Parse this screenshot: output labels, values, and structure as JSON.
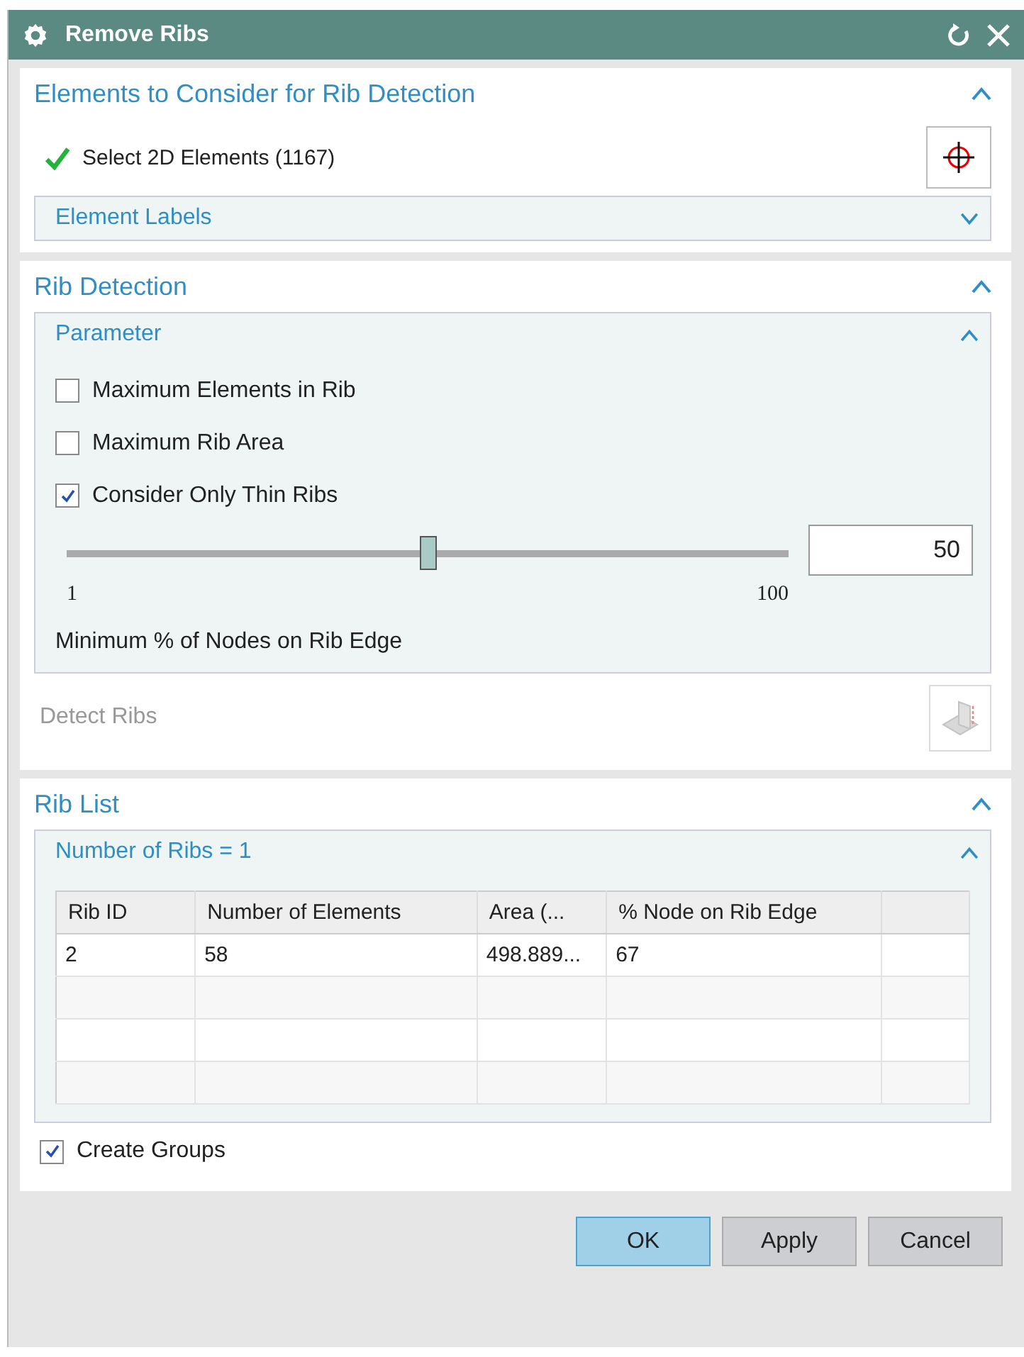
{
  "window": {
    "title": "Remove Ribs"
  },
  "sections": [
    {
      "kind": "selection",
      "title": "Elements to Consider for Rib Detection",
      "expanded": true,
      "selection": {
        "label": "Select 2D Elements (1167)",
        "complete": true
      },
      "subgroups": [
        {
          "title": "Element Labels",
          "expanded": false
        }
      ]
    },
    {
      "kind": "detection",
      "title": "Rib Detection",
      "expanded": true,
      "parameter": {
        "title": "Parameter",
        "expanded": true,
        "checks": [
          {
            "label": "Maximum Elements in Rib",
            "checked": false
          },
          {
            "label": "Maximum Rib Area",
            "checked": false
          },
          {
            "label": "Consider Only Thin Ribs",
            "checked": true
          }
        ],
        "slider": {
          "level": 0.5,
          "value": "50",
          "min": "1",
          "max": "100",
          "caption": "Minimum % of Nodes on Rib Edge"
        }
      },
      "action": {
        "label": "Detect Ribs",
        "disabled": true
      }
    },
    {
      "kind": "list",
      "title": "Rib List",
      "expanded": true,
      "group": {
        "title": "Number of Ribs = 1",
        "expanded": true
      },
      "table": {
        "columns": [
          "Rib ID",
          "Number of Elements",
          "Area (...",
          "% Node on Rib Edge",
          ""
        ],
        "rows": [
          [
            "2",
            "58",
            "498.889...",
            "67",
            ""
          ],
          [
            "",
            "",
            "",
            "",
            ""
          ],
          [
            "",
            "",
            "",
            "",
            ""
          ],
          [
            "",
            "",
            "",
            "",
            ""
          ]
        ]
      },
      "option": {
        "label": "Create Groups",
        "checked": true
      }
    }
  ],
  "buttons": [
    {
      "label": "OK",
      "default": true
    },
    {
      "label": "Apply",
      "default": false
    },
    {
      "label": "Cancel",
      "default": false
    }
  ]
}
